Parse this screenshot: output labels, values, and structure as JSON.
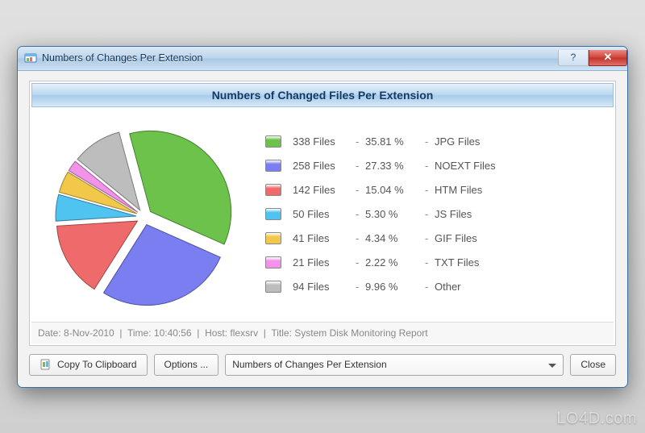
{
  "window": {
    "title": "Numbers of Changes Per Extension"
  },
  "panel": {
    "title": "Numbers of Changed Files Per Extension"
  },
  "chart_data": {
    "type": "pie",
    "title": "Numbers of Changed Files Per Extension",
    "categories": [
      "JPG Files",
      "NOEXT Files",
      "HTM Files",
      "JS Files",
      "GIF Files",
      "TXT Files",
      "Other"
    ],
    "values": [
      338,
      258,
      142,
      50,
      41,
      21,
      94
    ],
    "percentages": [
      35.81,
      27.33,
      15.04,
      5.3,
      4.34,
      2.22,
      9.96
    ],
    "colors": [
      "#6cc24a",
      "#7a7ef0",
      "#ef6b6b",
      "#4fc4f0",
      "#f2c84b",
      "#f293e9",
      "#bdbdbd"
    ]
  },
  "legend": [
    {
      "count": "338 Files",
      "pct": "35.81 %",
      "label": "JPG Files",
      "color": "#6cc24a"
    },
    {
      "count": "258 Files",
      "pct": "27.33 %",
      "label": "NOEXT Files",
      "color": "#7a7ef0"
    },
    {
      "count": "142 Files",
      "pct": "15.04 %",
      "label": "HTM Files",
      "color": "#ef6b6b"
    },
    {
      "count": "50 Files",
      "pct": "5.30 %",
      "label": "JS Files",
      "color": "#4fc4f0"
    },
    {
      "count": "41 Files",
      "pct": "4.34 %",
      "label": "GIF Files",
      "color": "#f2c84b"
    },
    {
      "count": "21 Files",
      "pct": "2.22 %",
      "label": "TXT Files",
      "color": "#f293e9"
    },
    {
      "count": "94 Files",
      "pct": "9.96 %",
      "label": "Other",
      "color": "#bdbdbd"
    }
  ],
  "status": {
    "date_label": "Date:",
    "date": "8-Nov-2010",
    "time_label": "Time:",
    "time": "10:40:56",
    "host_label": "Host:",
    "host": "flexsrv",
    "title_label": "Title:",
    "title": "System Disk Monitoring Report"
  },
  "footer": {
    "copy": "Copy To Clipboard",
    "options": "Options ...",
    "dropdown": "Numbers of Changes Per Extension",
    "close": "Close"
  },
  "watermark": "LO4D.com"
}
